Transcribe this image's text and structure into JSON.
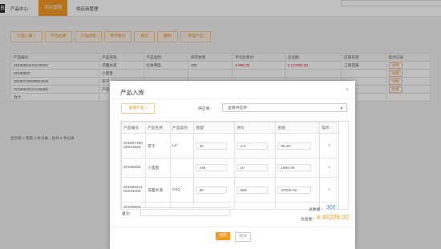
{
  "topbar": {
    "brand": "B",
    "nav": [
      "产品中心",
      "库存管理",
      "供应商管理"
    ]
  },
  "toolbar": [
    "产品入库 +",
    "产品出库",
    "产品调拨",
    "库存盘点",
    "导出",
    "删除",
    "筛选产品"
  ],
  "grid": {
    "headers": [
      "产品编号",
      "产品名称",
      "产品类别",
      "库存数量",
      "平均出售价",
      "企业额",
      "店铺名称",
      "盘点记录"
    ],
    "rows": [
      [
        "20180821102242002",
        "洗面水液",
        "化妆用品",
        "200",
        "¥ 988.00",
        "¥ 117600.00",
        "江南店铺",
        "详情"
      ],
      [
        "20180820",
        "小蜜蜜",
        "",
        "",
        "",
        "",
        "",
        "详情"
      ],
      [
        "20190726029914528",
        "李子",
        "",
        "",
        "",
        "",
        "",
        "详情"
      ],
      [
        "20180820121145283",
        "产品一",
        "",
        "",
        "",
        "",
        "",
        "详情"
      ],
      [
        "合计",
        "",
        "",
        "",
        "",
        "",
        "",
        ""
      ]
    ],
    "footer": "显示第 1 到第 4 条记录，总共 4 条记录"
  },
  "modal": {
    "title": "产品入库",
    "close": "×",
    "select_product": "选择产品 +",
    "supplier_label": "供应商：",
    "supplier_value": "查看供应商",
    "columns": [
      "产品编号",
      "产品名称",
      "产品类别",
      "数量",
      "进价",
      "金额",
      "操作"
    ],
    "rows": [
      {
        "code": "20190726029914528",
        "name": "李子",
        "category": "LZ",
        "qty": "20",
        "price": "4.8",
        "amount": "96.00",
        "op": "×"
      },
      {
        "code": "20180820",
        "name": "小蜜蜜",
        "category": "",
        "qty": "199",
        "price": "10",
        "amount": "1990.00",
        "op": "×"
      },
      {
        "code": "20180821102242002",
        "name": "洗面水液",
        "category": "XXQ",
        "qty": "80",
        "price": "588",
        "amount": "47040.00",
        "op": "×"
      },
      {
        "code": "20180820",
        "name": "",
        "category": "",
        "qty": "",
        "price": "",
        "amount": "",
        "op": ""
      }
    ],
    "remark_label": "备注：",
    "total_qty_label": "总数量：",
    "total_qty": "300",
    "total_amount_label": "总金额：",
    "total_amount": "¥ 49226.00",
    "save": "保存",
    "cancel": "取消"
  }
}
